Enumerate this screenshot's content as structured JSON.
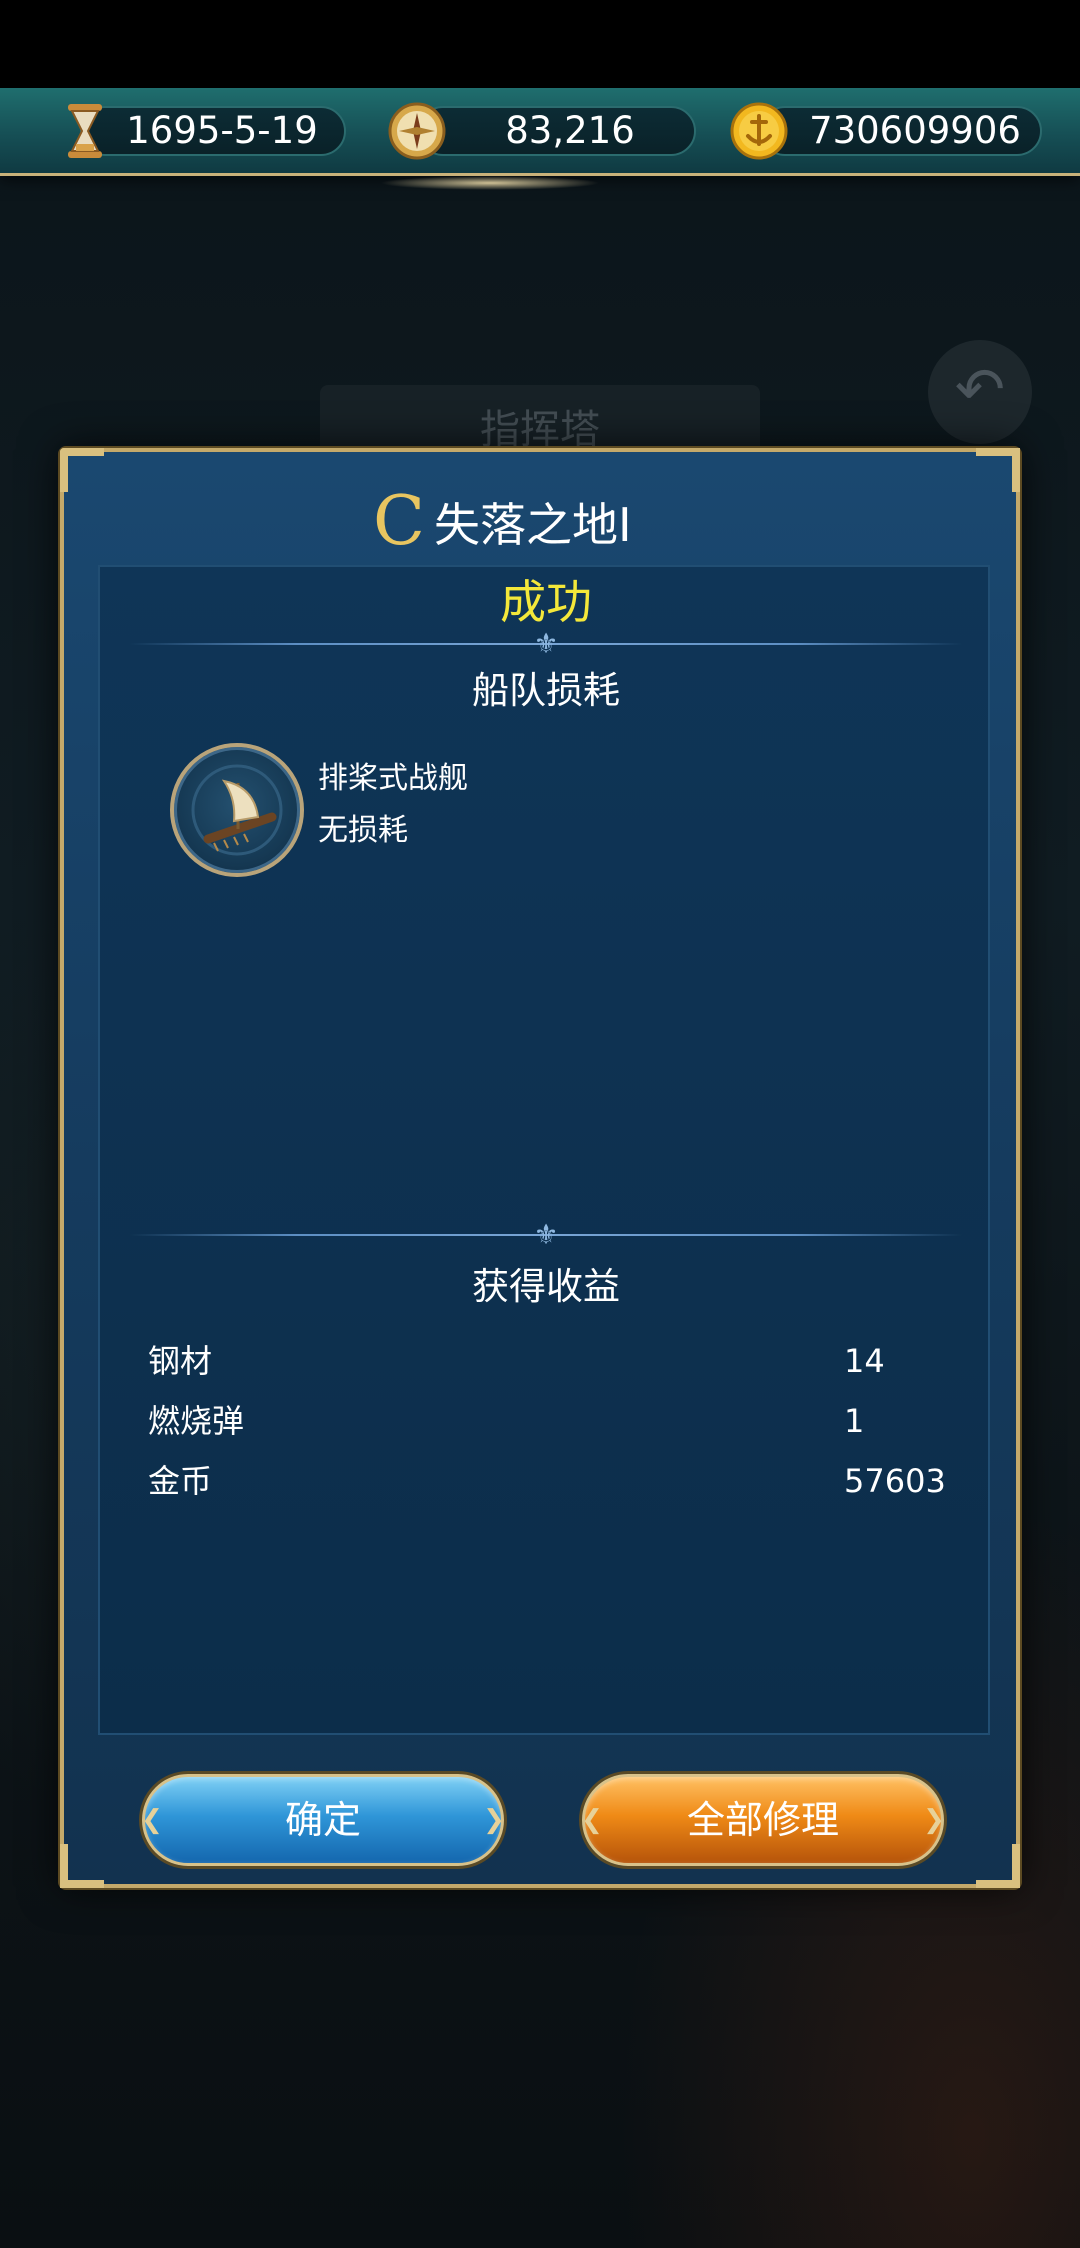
{
  "top_bar": {
    "date": "1695-5-19",
    "compass_value": "83,216",
    "gold": "730609906",
    "icons": [
      "hourglass-icon",
      "compass-icon",
      "anchor-coin-icon"
    ]
  },
  "background": {
    "tower_label": "指挥塔",
    "back_icon": "back-arrow-icon"
  },
  "dialog": {
    "rank_letter": "C",
    "title": "失落之地I",
    "result": "成功",
    "fleet_section_title": "船队损耗",
    "ship": {
      "name": "排桨式战舰",
      "damage": "无损耗",
      "icon": "galley-ship-icon"
    },
    "rewards_section_title": "获得收益",
    "rewards": [
      {
        "name": "钢材",
        "value": "14"
      },
      {
        "name": "燃烧弹",
        "value": "1"
      },
      {
        "name": "金币",
        "value": "57603"
      }
    ],
    "buttons": {
      "confirm": "确定",
      "repair_all": "全部修理"
    }
  },
  "colors": {
    "result": "#f4e83a",
    "rank": "#e8c560",
    "frame_gold": "#c4a96a",
    "confirm_blue": "#2f96d8",
    "repair_orange": "#ef8a16"
  }
}
